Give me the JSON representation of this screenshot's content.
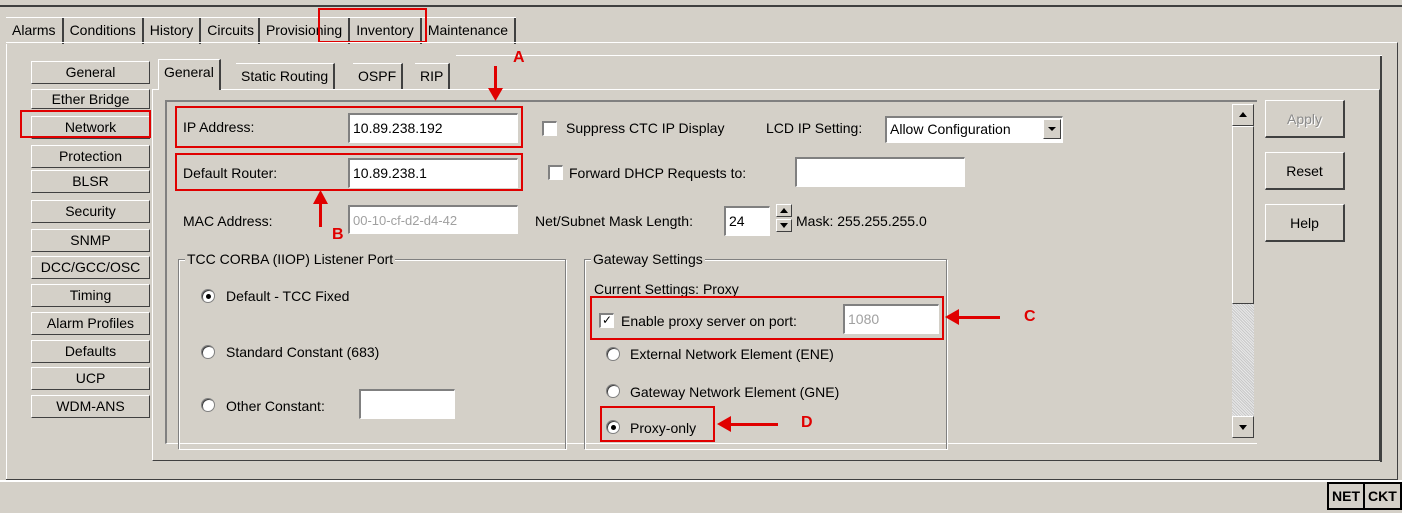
{
  "top_tabs": [
    "Alarms",
    "Conditions",
    "History",
    "Circuits",
    "Provisioning",
    "Inventory",
    "Maintenance"
  ],
  "nav_items": [
    "General",
    "Ether Bridge",
    "Network",
    "Protection",
    "BLSR",
    "Security",
    "SNMP",
    "DCC/GCC/OSC",
    "Timing",
    "Alarm Profiles",
    "Defaults",
    "UCP",
    "WDM-ANS"
  ],
  "inner_tabs": [
    "General",
    "Static Routing",
    "OSPF",
    "RIP"
  ],
  "form": {
    "ip_address_label": "IP Address:",
    "ip_address_value": "10.89.238.192",
    "default_router_label": "Default Router:",
    "default_router_value": "10.89.238.1",
    "mac_address_label": "MAC Address:",
    "mac_address_value": "00-10-cf-d2-d4-42",
    "suppress_ctc_label": "Suppress CTC IP Display",
    "lcd_ip_setting_label": "LCD IP Setting:",
    "lcd_ip_setting_value": "Allow Configuration",
    "forward_dhcp_label": "Forward DHCP Requests to:",
    "forward_dhcp_value": "",
    "net_mask_label": "Net/Subnet Mask Length:",
    "net_mask_value": "24",
    "mask_text": "Mask: 255.255.255.0"
  },
  "corba": {
    "title": "TCC CORBA (IIOP) Listener Port",
    "options": [
      "Default - TCC Fixed",
      "Standard Constant (683)",
      "Other Constant:"
    ],
    "selected": 0,
    "other_value": ""
  },
  "gateway": {
    "title": "Gateway Settings",
    "current": "Current Settings: Proxy",
    "enable_proxy_label": "Enable proxy server on port:",
    "enable_proxy_checked": true,
    "proxy_port": "1080",
    "options": [
      "External Network Element (ENE)",
      "Gateway Network Element (GNE)",
      "Proxy-only"
    ],
    "selected": 2
  },
  "buttons": {
    "apply": "Apply",
    "reset": "Reset",
    "help": "Help"
  },
  "annotations": {
    "a": "A",
    "b": "B",
    "c": "C",
    "d": "D",
    "color": "#e00000"
  },
  "status": {
    "net": "NET",
    "ckt": "CKT"
  },
  "icons": {
    "dropdown": "chevron-down-icon",
    "scroll_up": "scroll-up-icon",
    "scroll_down": "scroll-down-icon"
  }
}
